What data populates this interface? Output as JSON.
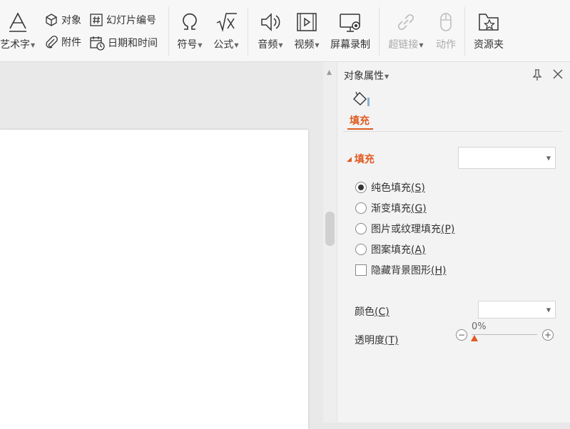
{
  "ribbon": {
    "wordart": "艺术字",
    "object": "对象",
    "attachment": "附件",
    "slide_number": "幻灯片编号",
    "datetime": "日期和时间",
    "symbol": "符号",
    "formula": "公式",
    "audio": "音频",
    "video": "视频",
    "screen_record": "屏幕录制",
    "hyperlink": "超链接",
    "action": "动作",
    "resources": "资源夹"
  },
  "panel": {
    "title": "对象属性",
    "tab_fill": "填充",
    "section_fill": "填充",
    "options": [
      {
        "label": "纯色填充",
        "key": "(S)",
        "selected": true
      },
      {
        "label": "渐变填充",
        "key": "(G)",
        "selected": false
      },
      {
        "label": "图片或纹理填充",
        "key": "(P)",
        "selected": false
      },
      {
        "label": "图案填充",
        "key": "(A)",
        "selected": false
      }
    ],
    "hide_bg": {
      "label": "隐藏背景图形",
      "key": "(H)",
      "checked": false
    },
    "color_label": "颜色",
    "color_key": "(C)",
    "transparency_label": "透明度",
    "transparency_key": "(T)",
    "transparency_value": "0%"
  },
  "colors": {
    "accent": "#e05a20"
  }
}
